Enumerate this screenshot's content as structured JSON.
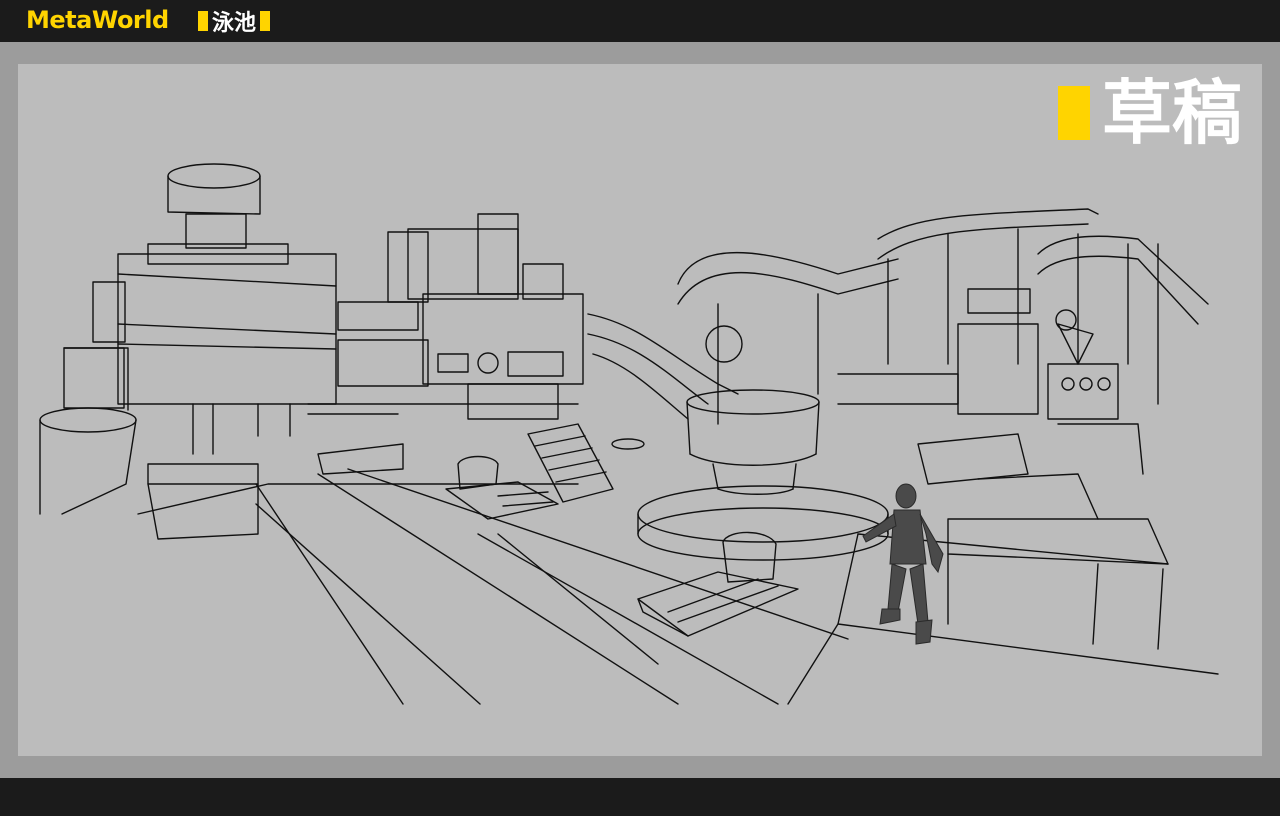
{
  "header": {
    "brand": "MetaWorld",
    "section": "泳池"
  },
  "canvas": {
    "label": "草稿"
  },
  "colors": {
    "accent": "#ffd400",
    "bar": "#1b1b1b",
    "frame": "#9c9c9c",
    "canvas": "#bcbcbc",
    "line": "#111111"
  }
}
